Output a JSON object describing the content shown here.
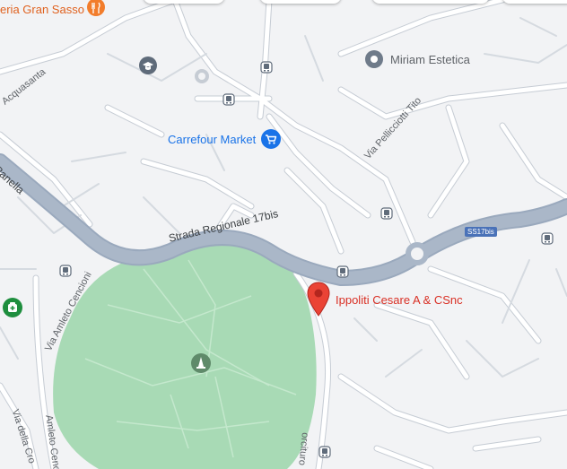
{
  "labels": {
    "poi_top_left": "eria Gran Sasso",
    "miriam": "Miriam Estetica",
    "carrefour": "Carrefour Market",
    "ippoliti": "Ippoliti Cesare A & CSnc"
  },
  "roads": {
    "acquasanta": "Acquasanta",
    "panella": "Panella",
    "strada_regionale": "Strada Regionale 17bis",
    "pellicciotti": "Via Pellicciotti Tito",
    "amleto_cencioni": "Via Amleto Cencioni",
    "cencioni": "Amleto Cencioni",
    "via_della_cro": "Via della Cro",
    "borcituro": "orcituro",
    "shield": "SS17bis"
  },
  "icons": {
    "restaurant": "restaurant-icon",
    "school": "school-icon",
    "bus_stop": "bus-stop-icon",
    "shopping_cart": "shopping-cart-icon",
    "place_marker": "place-marker-icon",
    "red_pin": "red-location-pin-icon",
    "pharmacy": "pharmacy-icon",
    "monument": "monument-icon"
  },
  "colors": {
    "background": "#f2f3f5",
    "park": "#a8dab5",
    "road_main": "#aab7c8",
    "road_minor": "#ffffff",
    "road_outline": "#c6ccd4",
    "pin": "#ea4335",
    "poi_blue": "#1a73e8",
    "poi_orange": "#f27d2c"
  }
}
